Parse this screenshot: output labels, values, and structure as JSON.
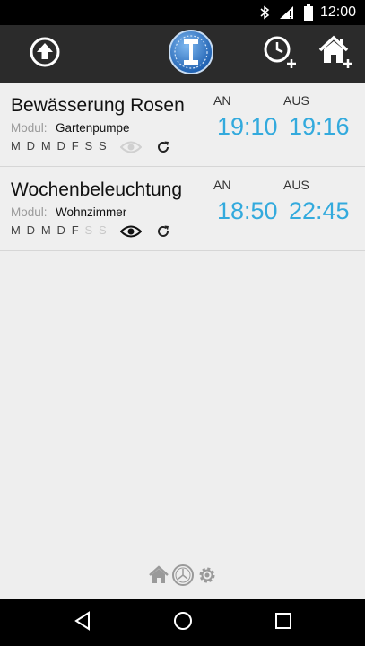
{
  "status_bar": {
    "time": "12:00",
    "icons": [
      "bluetooth-icon",
      "signal-icon",
      "battery-icon"
    ]
  },
  "action_bar": {
    "buttons": [
      "upload-icon",
      "app-logo",
      "add-timer-icon",
      "add-home-icon"
    ],
    "logo_text": "IT"
  },
  "labels": {
    "module": "Modul:",
    "on": "AN",
    "off": "AUS"
  },
  "timers": [
    {
      "name": "Bewässerung Rosen",
      "module": "Gartenpumpe",
      "days": [
        {
          "d": "M",
          "active": true
        },
        {
          "d": "D",
          "active": true
        },
        {
          "d": "M",
          "active": true
        },
        {
          "d": "D",
          "active": true
        },
        {
          "d": "F",
          "active": true
        },
        {
          "d": "S",
          "active": true
        },
        {
          "d": "S",
          "active": true
        }
      ],
      "visible": false,
      "on_time": "19:10",
      "off_time": "19:16"
    },
    {
      "name": "Wochenbeleuchtung",
      "module": "Wohnzimmer",
      "days": [
        {
          "d": "M",
          "active": true
        },
        {
          "d": "D",
          "active": true
        },
        {
          "d": "M",
          "active": true
        },
        {
          "d": "D",
          "active": true
        },
        {
          "d": "F",
          "active": true
        },
        {
          "d": "S",
          "active": false
        },
        {
          "d": "S",
          "active": false
        }
      ],
      "visible": true,
      "on_time": "18:50",
      "off_time": "22:45"
    }
  ],
  "footer": {
    "icons": [
      "home-icon",
      "clock-icon",
      "settings-icon"
    ]
  },
  "nav": {
    "icons": [
      "back-icon",
      "home-nav-icon",
      "recents-icon"
    ]
  },
  "colors": {
    "accent": "#33aadd",
    "action_bar": "#2b2b2b",
    "background": "#eeeeee"
  }
}
